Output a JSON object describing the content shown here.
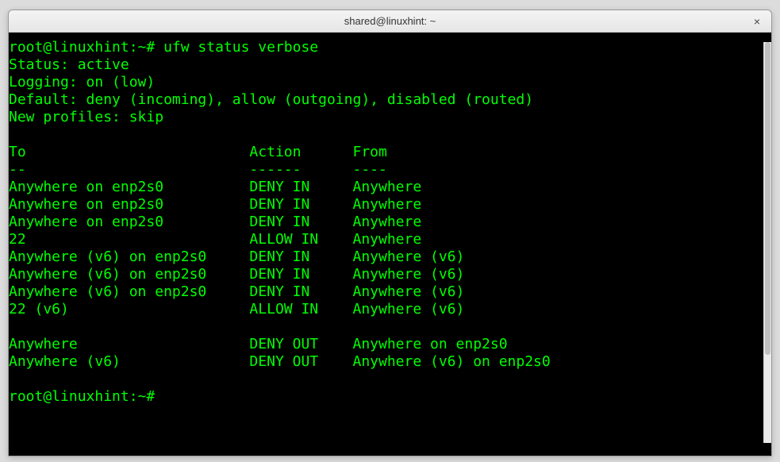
{
  "window": {
    "title": "shared@linuxhint: ~",
    "close_label": "×"
  },
  "terminal": {
    "prompt1_prefix": "root@linuxhint:~# ",
    "command1": "ufw status verbose",
    "status_line": "Status: active",
    "logging_line": "Logging: on (low)",
    "default_line": "Default: deny (incoming), allow (outgoing), disabled (routed)",
    "newprofiles_line": "New profiles: skip",
    "headers": {
      "to": "To",
      "action": "Action",
      "from": "From"
    },
    "header_sep": {
      "to": "--",
      "action": "------",
      "from": "----"
    },
    "rules_in": [
      {
        "to": "Anywhere on enp2s0",
        "action": "DENY IN",
        "from": "Anywhere"
      },
      {
        "to": "Anywhere on enp2s0",
        "action": "DENY IN",
        "from": "Anywhere"
      },
      {
        "to": "Anywhere on enp2s0",
        "action": "DENY IN",
        "from": "Anywhere"
      },
      {
        "to": "22",
        "action": "ALLOW IN",
        "from": "Anywhere"
      },
      {
        "to": "Anywhere (v6) on enp2s0",
        "action": "DENY IN",
        "from": "Anywhere (v6)"
      },
      {
        "to": "Anywhere (v6) on enp2s0",
        "action": "DENY IN",
        "from": "Anywhere (v6)"
      },
      {
        "to": "Anywhere (v6) on enp2s0",
        "action": "DENY IN",
        "from": "Anywhere (v6)"
      },
      {
        "to": "22 (v6)",
        "action": "ALLOW IN",
        "from": "Anywhere (v6)"
      }
    ],
    "rules_out": [
      {
        "to": "Anywhere",
        "action": "DENY OUT",
        "from": "Anywhere on enp2s0"
      },
      {
        "to": "Anywhere (v6)",
        "action": "DENY OUT",
        "from": "Anywhere (v6) on enp2s0"
      }
    ],
    "prompt2": "root@linuxhint:~# "
  }
}
